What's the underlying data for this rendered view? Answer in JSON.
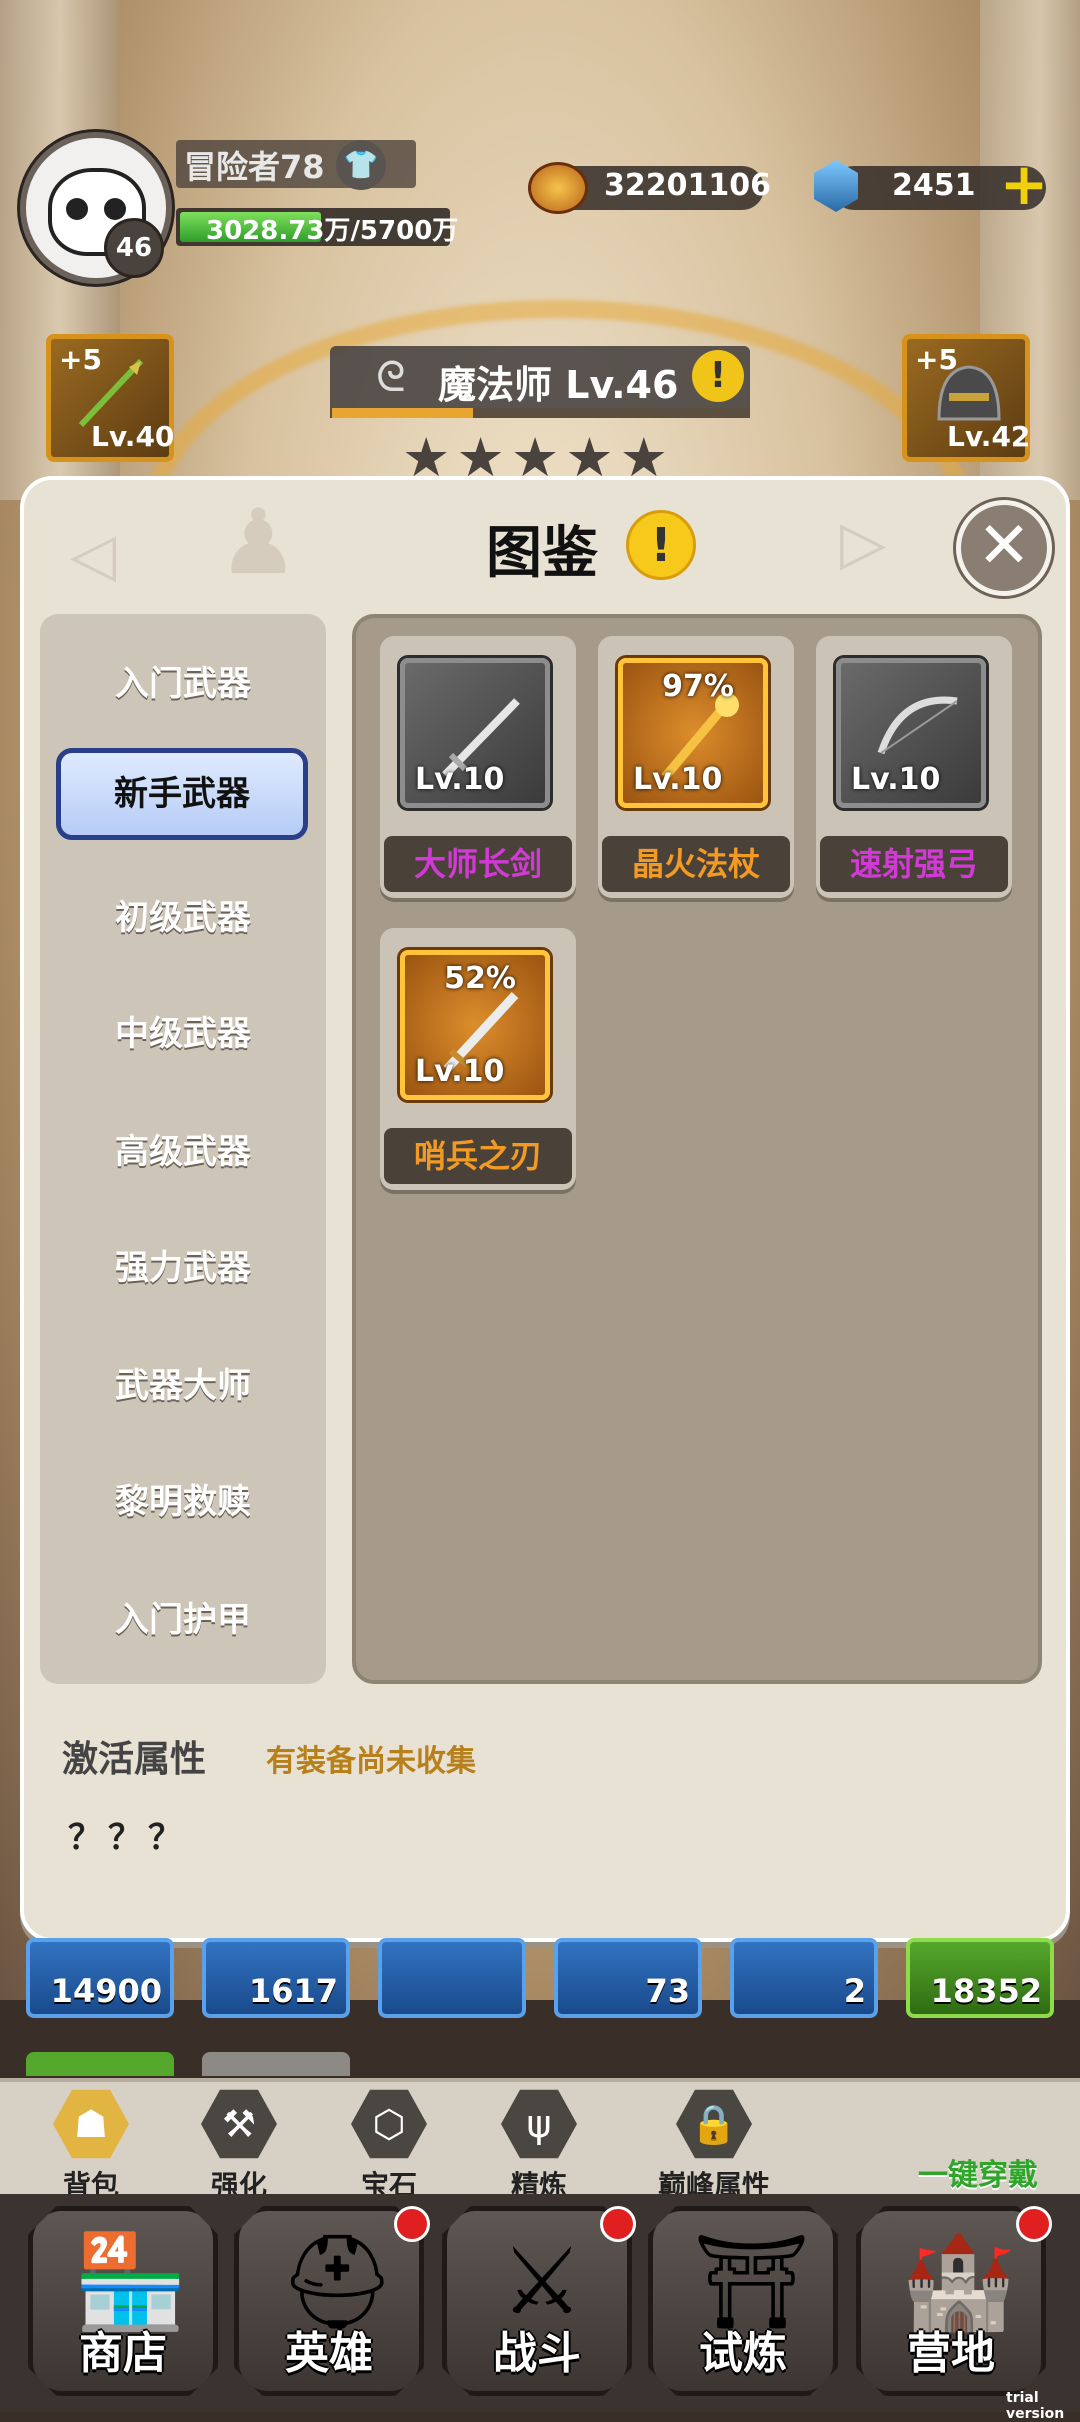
{
  "player": {
    "name": "冒险者78",
    "level": "46",
    "exp_current": "3028.73万",
    "exp_max": "/5700万",
    "exp_fraction": 0.53
  },
  "currency": {
    "gold": "32201106",
    "gems": "2451"
  },
  "equip_left": {
    "plus": "+5",
    "level": "Lv.40"
  },
  "equip_right": {
    "plus": "+5",
    "level": "Lv.42"
  },
  "hero_class": {
    "name": "魔法师 Lv.46",
    "progress_fraction": 0.34,
    "stars_filled": 0,
    "stars_total": 5
  },
  "modal": {
    "title": "图鉴",
    "categories": [
      "入门武器",
      "新手武器",
      "初级武器",
      "中级武器",
      "高级武器",
      "强力武器",
      "武器大师",
      "黎明救赎",
      "入门护甲"
    ],
    "selected_category": "新手武器",
    "items": [
      {
        "name": "大师长剑",
        "level": "Lv.10",
        "percent": "",
        "rarity": "gray",
        "name_color": "#d23ad6"
      },
      {
        "name": "晶火法杖",
        "level": "Lv.10",
        "percent": "97%",
        "rarity": "orange",
        "name_color": "#f29a23"
      },
      {
        "name": "速射强弓",
        "level": "Lv.10",
        "percent": "",
        "rarity": "gray",
        "name_color": "#d23ad6"
      },
      {
        "name": "哨兵之刃",
        "level": "Lv.10",
        "percent": "52%",
        "rarity": "orange",
        "name_color": "#f29a23"
      }
    ],
    "attr_label": "激活属性",
    "attr_note": "有装备尚未收集",
    "attr_value": "？？？"
  },
  "inventory_counts": [
    "14900",
    "1617",
    "",
    "73",
    "2",
    "18352"
  ],
  "subnav": [
    "背包",
    "强化",
    "宝石",
    "精炼",
    "巅峰属性"
  ],
  "one_key_equip": "一键穿戴",
  "bottomnav": [
    "商店",
    "英雄",
    "战斗",
    "试炼",
    "营地"
  ],
  "watermark": "trial version"
}
